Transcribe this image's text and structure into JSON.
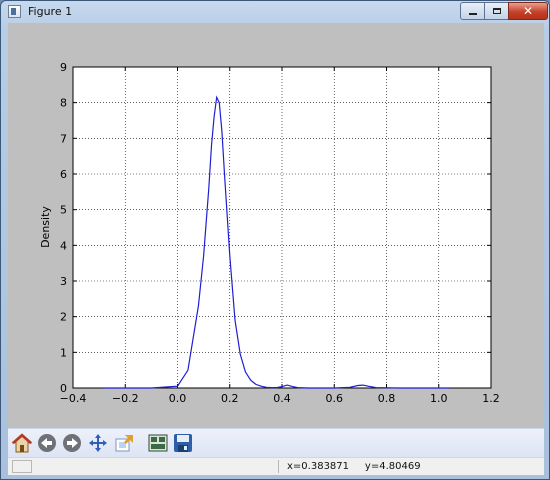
{
  "window": {
    "title": "Figure 1",
    "close_glyph": "✕"
  },
  "toolbar": {
    "buttons": [
      {
        "name": "home-button",
        "icon": "home-icon"
      },
      {
        "name": "back-button",
        "icon": "back-arrow-icon"
      },
      {
        "name": "forward-button",
        "icon": "forward-arrow-icon"
      },
      {
        "name": "pan-button",
        "icon": "pan-icon"
      },
      {
        "name": "zoom-button",
        "icon": "zoom-icon"
      },
      {
        "name": "subplots-button",
        "icon": "subplots-icon"
      },
      {
        "name": "save-button",
        "icon": "save-icon"
      }
    ]
  },
  "status": {
    "coords": "x=0.383871     y=4.80469"
  },
  "chart_data": {
    "type": "line",
    "ylabel": "Density",
    "xlim": [
      -0.4,
      1.2
    ],
    "ylim": [
      0,
      9
    ],
    "xticks": [
      "−0.4",
      "−0.2",
      "0.0",
      "0.2",
      "0.4",
      "0.6",
      "0.8",
      "1.0",
      "1.2"
    ],
    "yticks": [
      "0",
      "1",
      "2",
      "3",
      "4",
      "5",
      "6",
      "7",
      "8",
      "9"
    ],
    "grid": true,
    "colors": {
      "line": "#1f1fd1"
    },
    "series": [
      {
        "values_x": [
          -0.28,
          -0.1,
          0.0,
          0.04,
          0.08,
          0.1,
          0.12,
          0.13,
          0.14,
          0.15,
          0.16,
          0.17,
          0.18,
          0.2,
          0.22,
          0.24,
          0.26,
          0.28,
          0.3,
          0.32,
          0.34,
          0.36,
          0.38,
          0.4,
          0.42,
          0.44,
          0.46,
          0.5,
          0.6,
          0.66,
          0.69,
          0.71,
          0.73,
          0.76,
          0.85,
          1.0,
          1.04
        ],
        "values_y": [
          0.0,
          0.0,
          0.05,
          0.5,
          2.3,
          3.7,
          5.6,
          6.8,
          7.6,
          8.15,
          8.0,
          7.2,
          6.0,
          3.7,
          1.9,
          0.95,
          0.45,
          0.22,
          0.1,
          0.05,
          0.02,
          0.01,
          0.01,
          0.04,
          0.08,
          0.04,
          0.01,
          0.0,
          0.0,
          0.02,
          0.07,
          0.08,
          0.05,
          0.01,
          0.0,
          0.0,
          0.0
        ]
      }
    ]
  }
}
